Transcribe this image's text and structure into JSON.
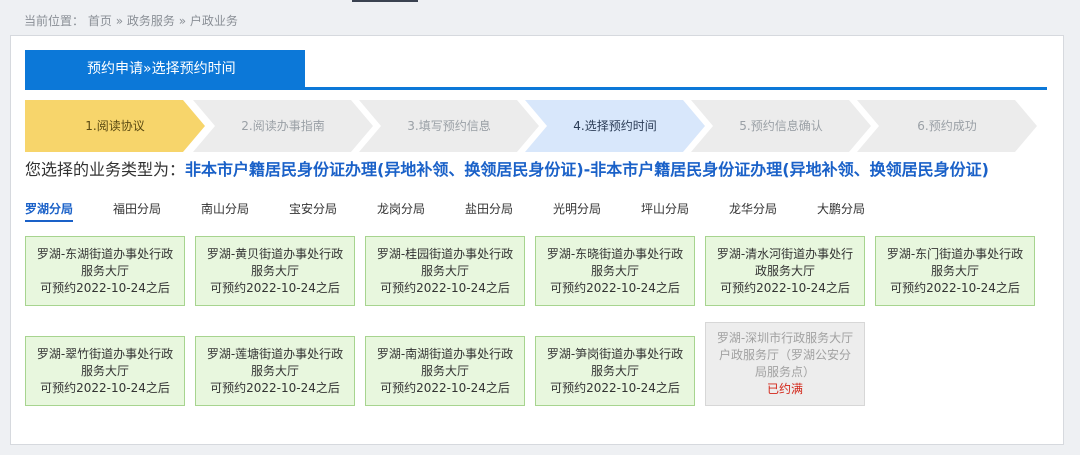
{
  "breadcrumb": {
    "prefix": "当前位置：",
    "items": [
      "首页",
      "政务服务",
      "户政业务"
    ],
    "sep": "»"
  },
  "title": "预约申请»选择预约时间",
  "steps": [
    {
      "label": "1.阅读协议",
      "state": "done"
    },
    {
      "label": "2.阅读办事指南",
      "state": "pending"
    },
    {
      "label": "3.填写预约信息",
      "state": "pending"
    },
    {
      "label": "4.选择预约时间",
      "state": "active"
    },
    {
      "label": "5.预约信息确认",
      "state": "pending"
    },
    {
      "label": "6.预约成功",
      "state": "pending"
    }
  ],
  "business": {
    "label": "您选择的业务类型为：",
    "value": "非本市户籍居民身份证办理(异地补领、换领居民身份证)-非本市户籍居民身份证办理(异地补领、换领居民身份证)"
  },
  "tabs": [
    "罗湖分局",
    "福田分局",
    "南山分局",
    "宝安分局",
    "龙岗分局",
    "盐田分局",
    "光明分局",
    "坪山分局",
    "龙华分局",
    "大鹏分局"
  ],
  "active_tab": 0,
  "cards": [
    {
      "line1": "罗湖-东湖街道办事处行政",
      "line2": "服务大厅",
      "line3": "可预约2022-10-24之后",
      "available": true
    },
    {
      "line1": "罗湖-黄贝街道办事处行政",
      "line2": "服务大厅",
      "line3": "可预约2022-10-24之后",
      "available": true
    },
    {
      "line1": "罗湖-桂园街道办事处行政",
      "line2": "服务大厅",
      "line3": "可预约2022-10-24之后",
      "available": true
    },
    {
      "line1": "罗湖-东晓街道办事处行政",
      "line2": "服务大厅",
      "line3": "可预约2022-10-24之后",
      "available": true
    },
    {
      "line1": "罗湖-清水河街道办事处行",
      "line2": "政服务大厅",
      "line3": "可预约2022-10-24之后",
      "available": true
    },
    {
      "line1": "罗湖-东门街道办事处行政",
      "line2": "服务大厅",
      "line3": "可预约2022-10-24之后",
      "available": true
    },
    {
      "line1": "罗湖-翠竹街道办事处行政",
      "line2": "服务大厅",
      "line3": "可预约2022-10-24之后",
      "available": true
    },
    {
      "line1": "罗湖-莲塘街道办事处行政",
      "line2": "服务大厅",
      "line3": "可预约2022-10-24之后",
      "available": true
    },
    {
      "line1": "罗湖-南湖街道办事处行政",
      "line2": "服务大厅",
      "line3": "可预约2022-10-24之后",
      "available": true
    },
    {
      "line1": "罗湖-笋岗街道办事处行政",
      "line2": "服务大厅",
      "line3": "可预约2022-10-24之后",
      "available": true
    },
    {
      "line1": "罗湖-深圳市行政服务大厅",
      "line2": "户政服务厅（罗湖公安分",
      "line3": "局服务点）",
      "status": "已约满",
      "available": false
    }
  ],
  "colors": {
    "accent": "#0c78d8",
    "step_done": "#f7d56b",
    "step_active": "#d8e7fb",
    "card_available": "#e8f7de",
    "card_full": "#ededed",
    "full_text": "#d3271a"
  }
}
